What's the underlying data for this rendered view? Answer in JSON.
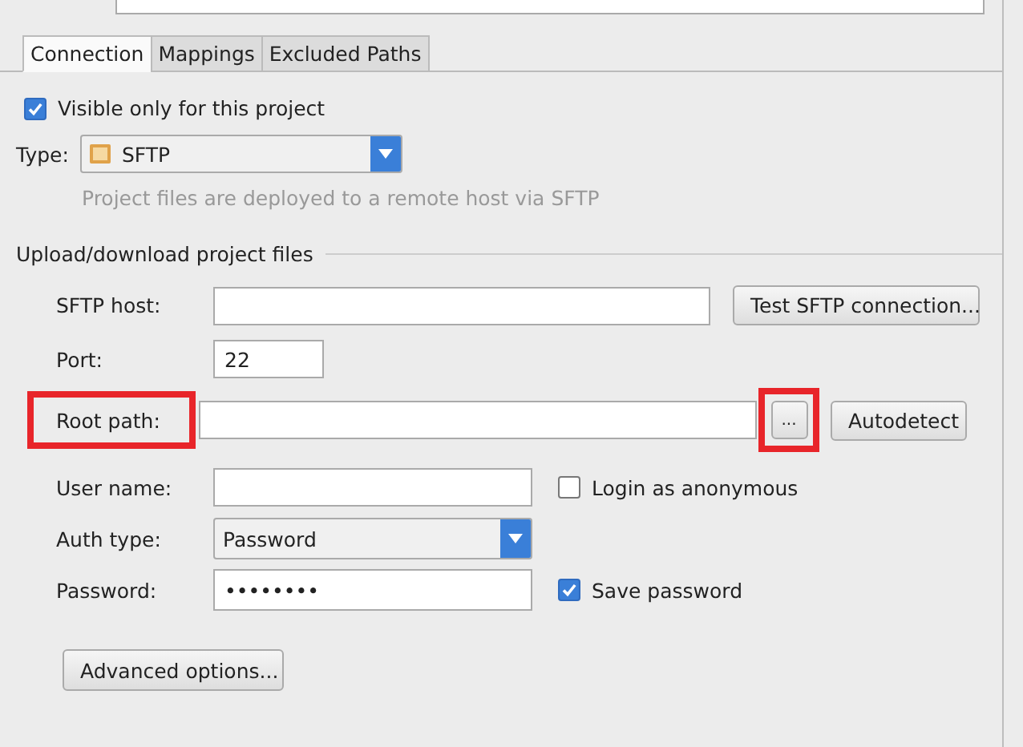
{
  "tabs": [
    {
      "label": "Connection",
      "selected": true
    },
    {
      "label": "Mappings",
      "selected": false
    },
    {
      "label": "Excluded Paths",
      "selected": false
    }
  ],
  "visible_only": {
    "label": "Visible only for this project",
    "checked": true
  },
  "type": {
    "label": "Type:",
    "value": "SFTP",
    "hint": "Project files are deployed to a remote host via SFTP"
  },
  "section": {
    "title": "Upload/download project files"
  },
  "sftp_host": {
    "label": "SFTP host:",
    "button": "Test SFTP connection..."
  },
  "port": {
    "label": "Port:",
    "value": "22"
  },
  "root_path": {
    "label": "Root path:",
    "browse": "...",
    "button": "Autodetect",
    "highlighted": true
  },
  "user_name": {
    "label": "User name:",
    "anonymous": {
      "label": "Login as anonymous",
      "checked": false
    }
  },
  "auth_type": {
    "label": "Auth type:",
    "value": "Password"
  },
  "password": {
    "label": "Password:",
    "value": "••••••••",
    "save": {
      "label": "Save password",
      "checked": true
    }
  },
  "advanced_button": "Advanced options..."
}
